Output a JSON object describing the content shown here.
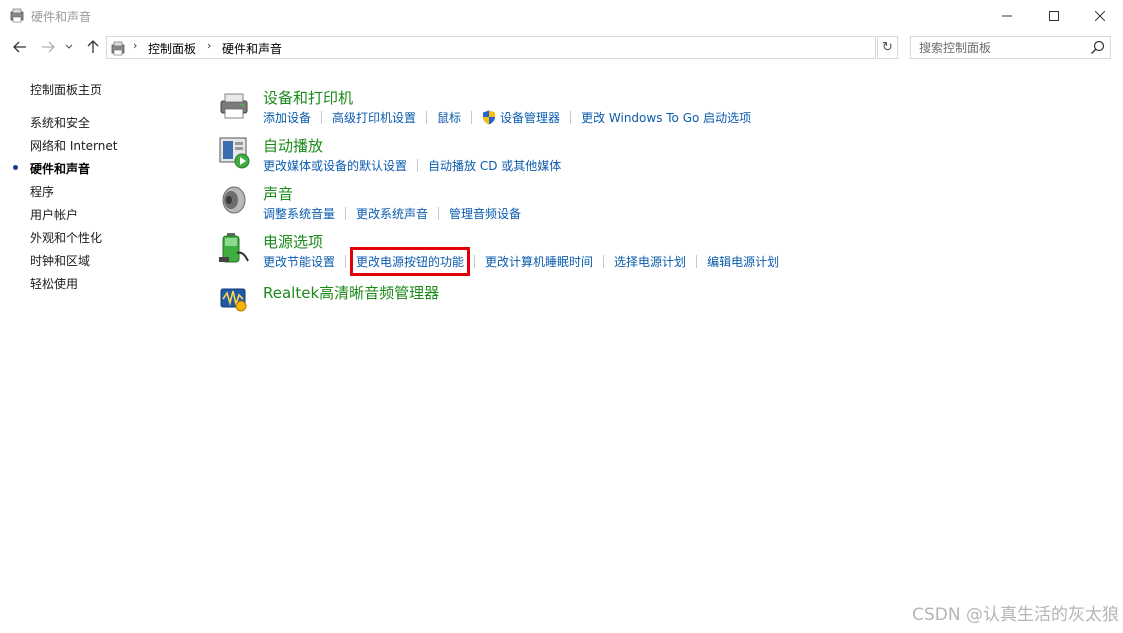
{
  "window": {
    "title": "硬件和声音"
  },
  "navigation": {
    "breadcrumbs": [
      "控制面板",
      "硬件和声音"
    ],
    "search_placeholder": "搜索控制面板"
  },
  "sidebar": {
    "items": [
      {
        "label": "控制面板主页",
        "active": false
      },
      {
        "label": "系统和安全",
        "active": false
      },
      {
        "label": "网络和 Internet",
        "active": false
      },
      {
        "label": "硬件和声音",
        "active": true
      },
      {
        "label": "程序",
        "active": false
      },
      {
        "label": "用户帐户",
        "active": false
      },
      {
        "label": "外观和个性化",
        "active": false
      },
      {
        "label": "时钟和区域",
        "active": false
      },
      {
        "label": "轻松使用",
        "active": false
      }
    ]
  },
  "categories": [
    {
      "title": "设备和打印机",
      "icon": "printer-icon",
      "links": [
        "添加设备",
        "高级打印机设置",
        "鼠标",
        "设备管理器",
        "更改 Windows To Go 启动选项"
      ]
    },
    {
      "title": "自动播放",
      "icon": "autoplay-icon",
      "links": [
        "更改媒体或设备的默认设置",
        "自动播放 CD 或其他媒体"
      ]
    },
    {
      "title": "声音",
      "icon": "speaker-icon",
      "links": [
        "调整系统音量",
        "更改系统声音",
        "管理音频设备"
      ]
    },
    {
      "title": "电源选项",
      "icon": "battery-icon",
      "links": [
        "更改节能设置",
        "更改电源按钮的功能",
        "更改计算机睡眠时间",
        "选择电源计划",
        "编辑电源计划"
      ]
    },
    {
      "title": "Realtek高清晰音频管理器",
      "icon": "realtek-audio-icon",
      "links": []
    }
  ],
  "highlighted_link": "更改电源按钮的功能",
  "colors": {
    "category_title": "#1a8a1a",
    "link": "#0b5cad",
    "highlight_box": "#e0000a"
  },
  "watermark": "CSDN @认真生活的灰太狼"
}
